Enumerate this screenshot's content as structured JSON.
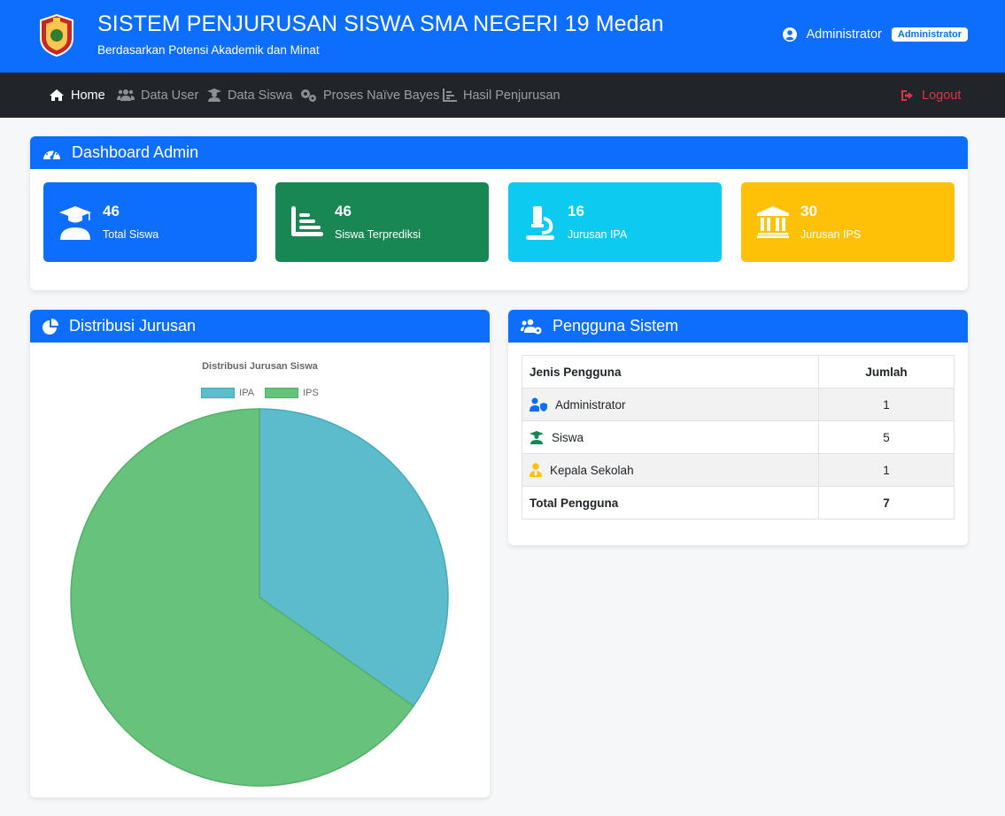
{
  "header": {
    "title": "SISTEM PENJURUSAN SISWA SMA NEGERI 19 Medan",
    "subtitle": "Berdasarkan Potensi Akademik dan Minat",
    "user_name": "Administrator",
    "user_role": "Administrator"
  },
  "nav": {
    "items": [
      {
        "label": "Home",
        "icon": "home-icon"
      },
      {
        "label": "Data User",
        "icon": "users-icon"
      },
      {
        "label": "Data Siswa",
        "icon": "student-icon"
      },
      {
        "label": "Proses Naïve Bayes",
        "icon": "gears-icon"
      },
      {
        "label": "Hasil Penjurusan",
        "icon": "chart-icon"
      }
    ],
    "logout": "Logout"
  },
  "dashboard": {
    "title": "Dashboard Admin",
    "stats": [
      {
        "value": "46",
        "label": "Total Siswa",
        "color": "#0d6efd",
        "icon": "graduate-icon"
      },
      {
        "value": "46",
        "label": "Siswa Terprediksi",
        "color": "#198754",
        "icon": "bar-chart-icon"
      },
      {
        "value": "16",
        "label": "Jurusan IPA",
        "color": "#0dcaf0",
        "icon": "microscope-icon"
      },
      {
        "value": "30",
        "label": "Jurusan IPS",
        "color": "#ffc107",
        "icon": "landmark-icon"
      }
    ]
  },
  "distribution": {
    "card_title": "Distribusi Jurusan"
  },
  "chart_data": {
    "type": "pie",
    "title": "Distribusi Jurusan Siswa",
    "categories": [
      "IPA",
      "IPS"
    ],
    "values": [
      16,
      30
    ],
    "colors": [
      "#5bbccc",
      "#67c27b"
    ],
    "legend": "top"
  },
  "users_table": {
    "title": "Pengguna Sistem",
    "headers": [
      "Jenis Pengguna",
      "Jumlah"
    ],
    "rows": [
      {
        "label": "Administrator",
        "count": "1",
        "icon": "user-shield-icon"
      },
      {
        "label": "Siswa",
        "count": "5",
        "icon": "graduate-icon"
      },
      {
        "label": "Kepala Sekolah",
        "count": "1",
        "icon": "user-tie-icon"
      }
    ],
    "total_label": "Total Pengguna",
    "total_count": "7"
  }
}
